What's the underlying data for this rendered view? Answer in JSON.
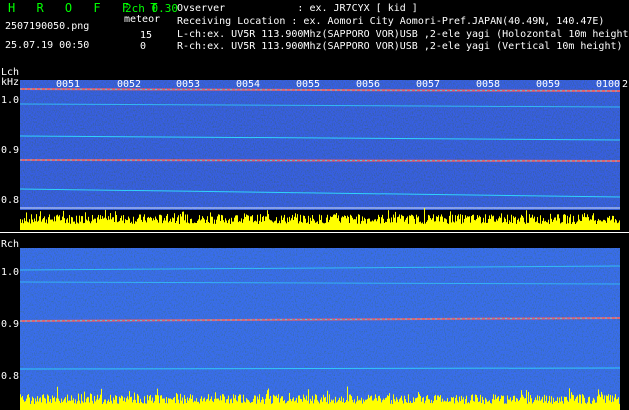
{
  "header": {
    "title": "H R O F F T",
    "version": "2ch 0.30",
    "filename": "2507190050.png",
    "mode": "meteor",
    "count": "15",
    "count2": "0",
    "datetime": "25.07.19 00:50"
  },
  "info": {
    "observer": "Ovserver            : ex. JR7CYX [ kid ]",
    "location": "Receiving Location : ex. Aomori City Aomori-Pref.JAPAN(40.49N, 140.47E)",
    "lch": "L-ch:ex. UV5R 113.900Mhz(SAPPORO VOR)USB ,2-ele yagi (Holozontal 10m height)",
    "rch": "R-ch:ex. UV5R 113.900Mhz(SAPPORO VOR)USB ,2-ele yagi (Vertical 10m height)"
  },
  "lch_panel": {
    "label": "Lch",
    "unit": "kHz",
    "yticks": [
      "1.0",
      "0.9",
      "0.8"
    ],
    "time_labels": [
      "0051",
      "0052",
      "0053",
      "0054",
      "0055",
      "0056",
      "0057",
      "0058",
      "0059",
      "0100"
    ],
    "end_mark": "2"
  },
  "rch_panel": {
    "label": "Rch",
    "yticks": [
      "1.0",
      "0.9",
      "0.8"
    ]
  },
  "colors": {
    "noise_bg": "#0a1a6e",
    "carrier": "#ff3030",
    "trace": "#30e0ff",
    "baseline": "#ffff00"
  }
}
